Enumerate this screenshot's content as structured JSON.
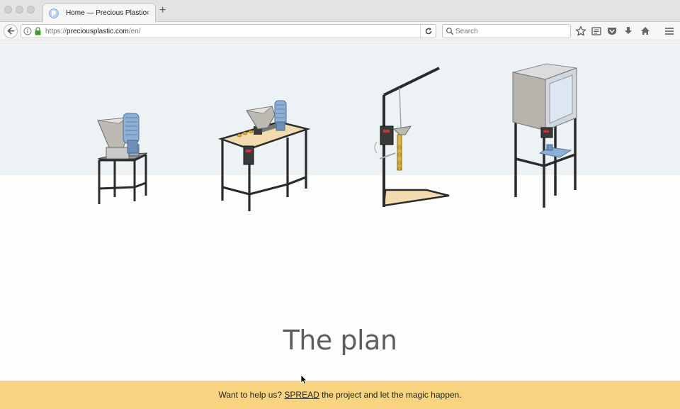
{
  "browser": {
    "tab": {
      "title": "Home — Precious Plastic",
      "close_glyph": "×",
      "favicon": "precious-plastic-logo"
    },
    "new_tab_glyph": "+",
    "url": {
      "scheme": "https://",
      "host": "preciousplastic.com",
      "path": "/en/"
    },
    "search": {
      "placeholder": "Search",
      "value": ""
    },
    "toolbar_icons": [
      "bookmark-star-icon",
      "reading-list-icon",
      "pocket-icon",
      "download-icon",
      "home-icon",
      "menu-icon"
    ]
  },
  "hero": {
    "background": "#edf2f5",
    "machines": [
      "shredder",
      "extruder",
      "injection",
      "compression"
    ]
  },
  "main": {
    "heading": "The plan"
  },
  "banner": {
    "background": "#f8d480",
    "before": "Want to help us? ",
    "link": "SPREAD",
    "after": " the project and let the magic happen."
  }
}
